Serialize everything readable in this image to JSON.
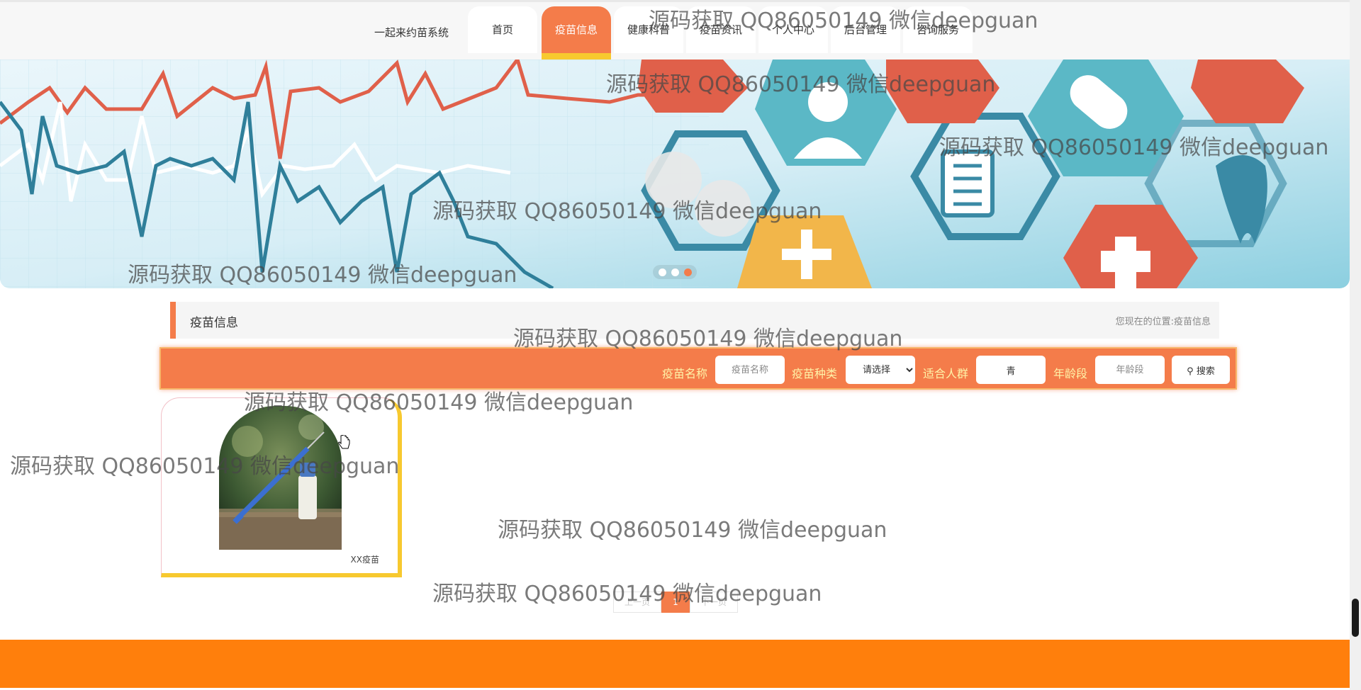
{
  "header": {
    "brand": "一起来约苗系统",
    "nav": [
      {
        "label": "首页",
        "active": false
      },
      {
        "label": "疫苗信息",
        "active": true
      },
      {
        "label": "健康科普",
        "active": false
      },
      {
        "label": "疫苗资讯",
        "active": false
      },
      {
        "label": "个人中心",
        "active": false
      },
      {
        "label": "后台管理",
        "active": false
      },
      {
        "label": "咨询服务",
        "active": false
      }
    ]
  },
  "banner": {
    "slide_count": 3,
    "active_slide_index": 2
  },
  "section": {
    "title": "疫苗信息",
    "breadcrumb_prefix": "您现在的位置:",
    "breadcrumb_current": "疫苗信息"
  },
  "search": {
    "name_label": "疫苗名称",
    "name_placeholder": "疫苗名称",
    "type_label": "疫苗种类",
    "type_selected": "请选择",
    "crowd_label": "适合人群",
    "crowd_value": "青",
    "age_label": "年龄段",
    "age_placeholder": "年龄段",
    "button_label": "搜索"
  },
  "vaccines": [
    {
      "name": "XX疫苗"
    }
  ],
  "pagination": {
    "prev": "上一页",
    "current": "1",
    "next": "下一页"
  },
  "watermark": "源码获取 QQ86050149 微信deepguan",
  "colors": {
    "accent": "#f47c4a",
    "highlight": "#f7c92f",
    "footer": "#ff7f0c"
  }
}
